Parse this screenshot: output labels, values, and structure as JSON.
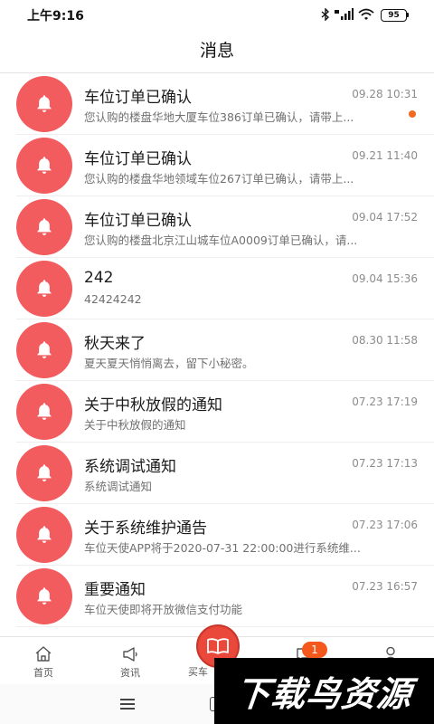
{
  "status_bar": {
    "time": "上午9:16",
    "battery_level": "95",
    "icons": [
      "bluetooth-icon",
      "signal-icon",
      "wifi-icon",
      "battery-icon"
    ]
  },
  "header": {
    "title": "消息"
  },
  "colors": {
    "bell_background": "#F25C5F",
    "unread_dot": "#F26A22",
    "tab_badge": "#F4581C",
    "center_button": "#E9483A"
  },
  "messages": [
    {
      "icon": "bell-icon",
      "title": "车位订单已确认",
      "time": "09.28 10:31",
      "preview": "您认购的楼盘华地大厦车位386订单已确认，请带上...",
      "unread": true
    },
    {
      "icon": "bell-icon",
      "title": "车位订单已确认",
      "time": "09.21 11:40",
      "preview": "您认购的楼盘华地领域车位267订单已确认，请带上...",
      "unread": false
    },
    {
      "icon": "bell-icon",
      "title": "车位订单已确认",
      "time": "09.04 17:52",
      "preview": "您认购的楼盘北京江山城车位A0009订单已确认，请...",
      "unread": false
    },
    {
      "icon": "bell-icon",
      "title": "242",
      "time": "09.04 15:36",
      "preview": "42424242",
      "unread": false
    },
    {
      "icon": "bell-icon",
      "title": "秋天来了",
      "time": "08.30 11:58",
      "preview": "夏天夏天悄悄离去，留下小秘密。",
      "unread": false
    },
    {
      "icon": "bell-icon",
      "title": "关于中秋放假的通知",
      "time": "07.23 17:19",
      "preview": "关于中秋放假的通知",
      "unread": false
    },
    {
      "icon": "bell-icon",
      "title": "系统调试通知",
      "time": "07.23 17:13",
      "preview": "系统调试通知",
      "unread": false
    },
    {
      "icon": "bell-icon",
      "title": "关于系统维护通告",
      "time": "07.23 17:06",
      "preview": "车位天使APP将于2020-07-31 22:00:00进行系统维...",
      "unread": false
    },
    {
      "icon": "bell-icon",
      "title": "重要通知",
      "time": "07.23 16:57",
      "preview": "车位天使即将开放微信支付功能",
      "unread": false
    }
  ],
  "tabbar": {
    "items": [
      {
        "label": "首页",
        "icon": "home-icon"
      },
      {
        "label": "资讯",
        "icon": "megaphone-icon"
      },
      {
        "label": "买车",
        "icon": "book-icon"
      },
      {
        "icon": "chat-bubble-icon"
      },
      {
        "icon": "person-icon"
      }
    ],
    "message_badge": "1"
  },
  "system_nav": {
    "icons": [
      "menu-icon",
      "home-square-icon"
    ]
  },
  "watermark": {
    "text": "下载鸟资源"
  }
}
